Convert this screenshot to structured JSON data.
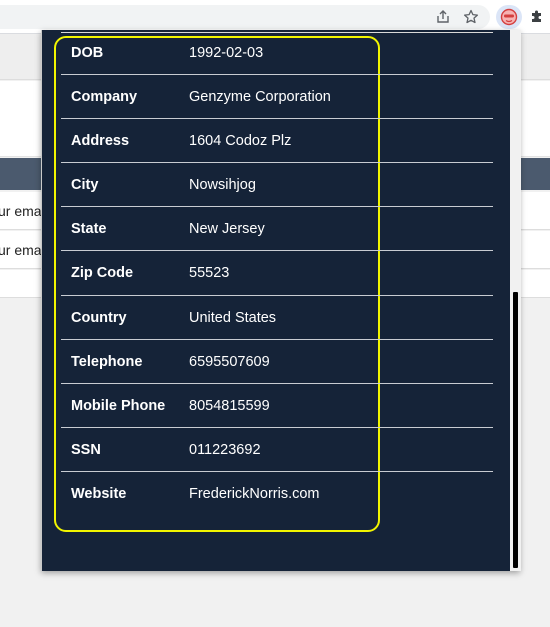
{
  "browser": {
    "icons": {
      "share": "share-icon",
      "star": "bookmark-star-icon",
      "extension": "extension-face-icon",
      "puzzle": "extensions-puzzle-icon"
    },
    "colors": {
      "extension_active_bg": "#dbe5f7"
    }
  },
  "background_page": {
    "rows": [
      {
        "text": "ur email"
      },
      {
        "text": "ur email"
      }
    ]
  },
  "popup": {
    "colors": {
      "background": "#152338",
      "highlight_border": "#f2f500",
      "text": "#ffffff"
    },
    "fields": [
      {
        "label": "DOB",
        "value": "1992-02-03"
      },
      {
        "label": "Company",
        "value": "Genzyme Corporation"
      },
      {
        "label": "Address",
        "value": "1604 Codoz Plz"
      },
      {
        "label": "City",
        "value": "Nowsihjog"
      },
      {
        "label": "State",
        "value": "New Jersey"
      },
      {
        "label": "Zip Code",
        "value": "55523"
      },
      {
        "label": "Country",
        "value": "United States"
      },
      {
        "label": "Telephone",
        "value": "6595507609"
      },
      {
        "label": "Mobile Phone",
        "value": "8054815599"
      },
      {
        "label": "SSN",
        "value": "011223692"
      },
      {
        "label": "Website",
        "value": "FrederickNorris.com"
      }
    ]
  }
}
